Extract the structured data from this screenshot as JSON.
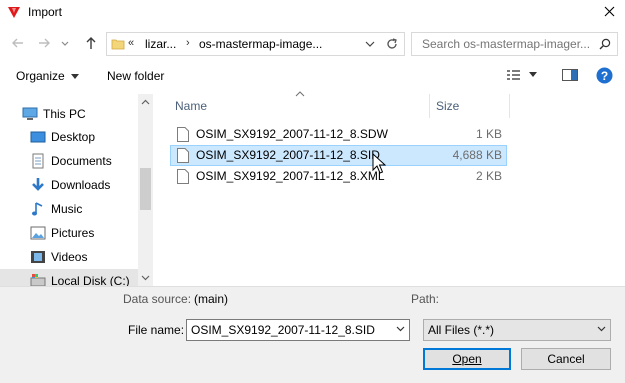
{
  "window": {
    "title": "Import",
    "brand_color": "#e01a1a"
  },
  "navbar": {
    "back_icon": "arrow-left-icon",
    "forward_icon": "arrow-right-icon",
    "recent_icon": "chevron-down-icon",
    "up_icon": "arrow-up-icon",
    "overflow": "«",
    "crumb1": "lizar...",
    "crumb_sep": "›",
    "crumb2": "os-mastermap-image...",
    "search_placeholder": "Search os-mastermap-imager..."
  },
  "toolbar": {
    "organize": "Organize",
    "new_folder": "New folder"
  },
  "sidebar": {
    "items": [
      {
        "label": "This PC",
        "icon": "computer-icon"
      },
      {
        "label": "Desktop",
        "icon": "desktop-icon"
      },
      {
        "label": "Documents",
        "icon": "documents-icon"
      },
      {
        "label": "Downloads",
        "icon": "download-icon"
      },
      {
        "label": "Music",
        "icon": "music-icon"
      },
      {
        "label": "Pictures",
        "icon": "pictures-icon"
      },
      {
        "label": "Videos",
        "icon": "videos-icon"
      },
      {
        "label": "Local Disk (C:)",
        "icon": "disk-icon"
      }
    ]
  },
  "filelist": {
    "columns": {
      "name": "Name",
      "size": "Size"
    },
    "files": [
      {
        "name": "OSIM_SX9192_2007-11-12_8.SDW",
        "size": "1 KB"
      },
      {
        "name": "OSIM_SX9192_2007-11-12_8.SID",
        "size": "4,688 KB"
      },
      {
        "name": "OSIM_SX9192_2007-11-12_8.XML",
        "size": "2 KB"
      }
    ],
    "selected_index": 1,
    "selection_color": "#cce8ff"
  },
  "bottom": {
    "data_source_label": "Data source:",
    "data_source_value": "(main)",
    "path_label": "Path:",
    "filename_label": "File name:",
    "filename_value": "OSIM_SX9192_2007-11-12_8.SID",
    "filetype_value": "All Files (*.*)",
    "open_label": "Open",
    "cancel_label": "Cancel"
  }
}
